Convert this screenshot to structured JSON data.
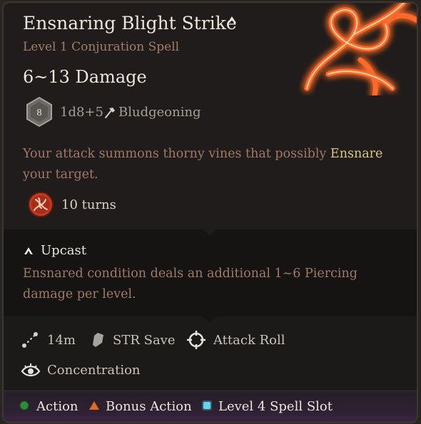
{
  "spell": {
    "name": "Ensnaring Blight Strike",
    "subtitle": "Level 1 Conjuration Spell",
    "damage": "6~13 Damage",
    "dice_face": "8",
    "dice": "1d8+5",
    "damage_type": "Bludgeoning",
    "description_start": "Your attack summons thorny vines that possibly ",
    "description_keyword": "Ensnare",
    "description_end": " your target.",
    "duration": "10 turns"
  },
  "upcast": {
    "label": "Upcast",
    "description": "Ensnared condition deals an additional 1~6 Piercing damage per level."
  },
  "properties": {
    "range": "14m",
    "save": "STR Save",
    "attack": "Attack Roll",
    "concentration": "Concentration"
  },
  "costs": {
    "action": "Action",
    "bonus_action": "Bonus Action",
    "spell_slot": "Level 4 Spell Slot"
  },
  "colors": {
    "action": "#2f8a3a",
    "bonus_action": "#e8661e",
    "spell_slot": "#62d7f0",
    "highlight": "#dcc87e",
    "rune_glow": "#ff5a1f"
  },
  "icons": {
    "title": "upcast-chevron-icon",
    "dice": "d8-dice-icon",
    "weapon": "hammer-icon",
    "duration": "ensnare-condition-icon",
    "range": "range-icon",
    "save": "shield-save-icon",
    "attack": "crosshair-icon",
    "concentration": "concentration-eye-icon"
  }
}
